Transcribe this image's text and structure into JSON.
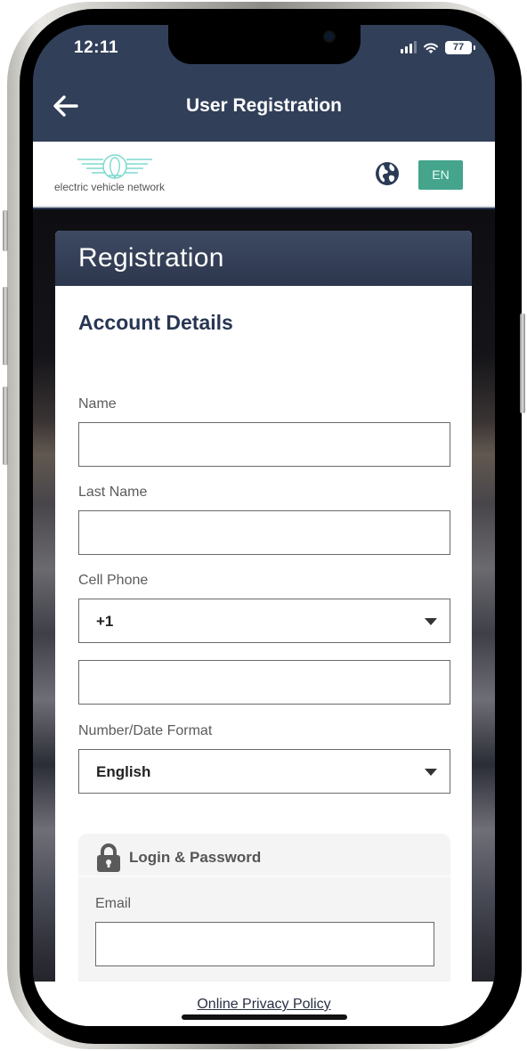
{
  "status_bar": {
    "time": "12:11",
    "battery": "77",
    "icons": [
      "cellular-signal-icon",
      "wifi-icon",
      "battery-icon"
    ]
  },
  "app_bar": {
    "back_icon": "arrow-left-icon",
    "title": "User Registration"
  },
  "brand_bar": {
    "logo_text": "electric vehicle network",
    "logo_color": "#7fd9cf",
    "globe_icon": "globe-icon",
    "language_button": "EN",
    "language_button_color": "#44a48c"
  },
  "card": {
    "header": "Registration",
    "section_title": "Account Details",
    "fields": {
      "name": {
        "label": "Name",
        "value": ""
      },
      "last_name": {
        "label": "Last Name",
        "value": ""
      },
      "cell_phone": {
        "label": "Cell Phone",
        "country_code": "+1",
        "number": ""
      },
      "number_date_format": {
        "label": "Number/Date Format",
        "selected": "English"
      }
    },
    "login_section": {
      "icon": "lock-icon",
      "title": "Login & Password",
      "email": {
        "label": "Email",
        "value": ""
      }
    }
  },
  "footer": {
    "privacy_link": "Online Privacy Policy"
  },
  "colors": {
    "app_bar": "#313f59",
    "card_header": "#2c374e",
    "section_title": "#283654"
  }
}
